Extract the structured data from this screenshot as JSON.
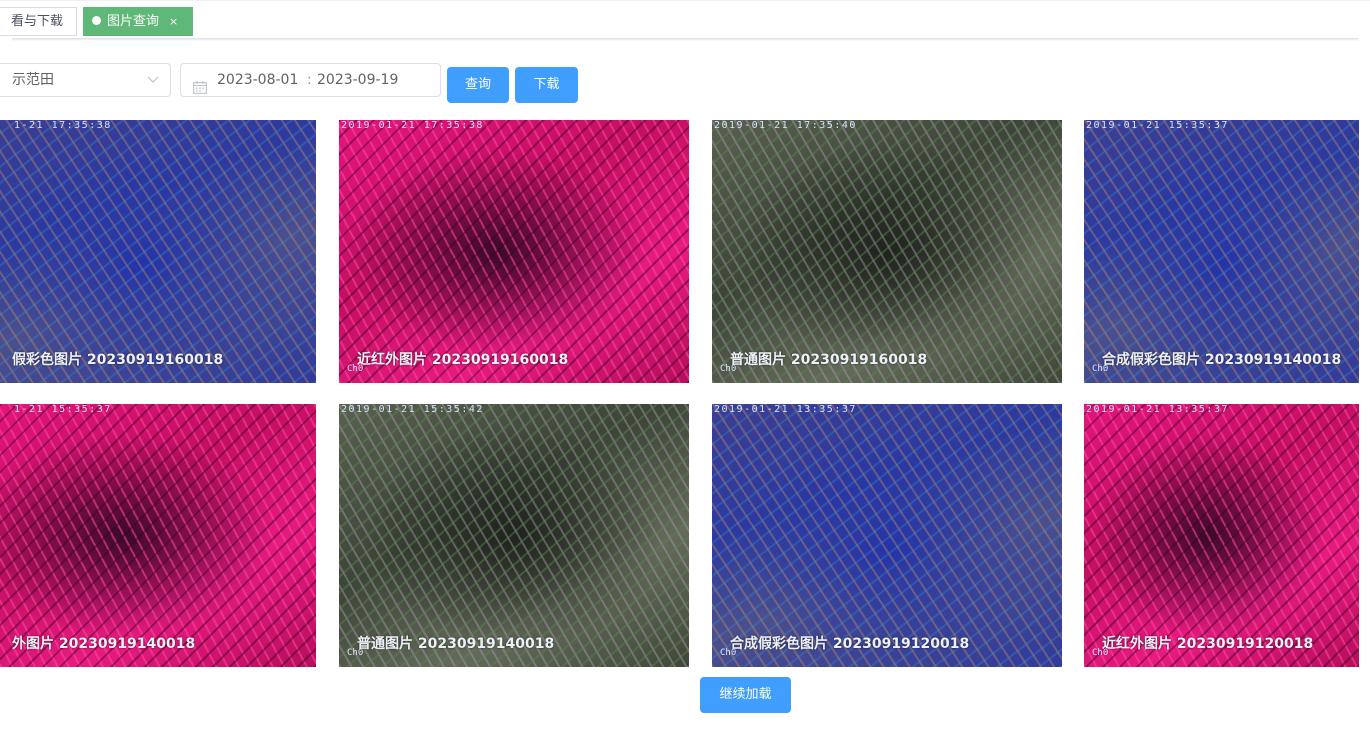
{
  "tabs": [
    {
      "label": "看与下载",
      "active": false
    },
    {
      "label": "图片查询",
      "active": true,
      "close": "×"
    }
  ],
  "filters": {
    "select_value": "示范田",
    "date_start": "2023-08-01",
    "date_sep": ":",
    "date_end": "2023-09-19"
  },
  "buttons": {
    "query": "查询",
    "download": "下载",
    "load_more": "继续加载"
  },
  "images": [
    {
      "type": "falsecolor",
      "stamp": "1-21 17:35:38",
      "ch": "",
      "caption": "假彩色图片 20230919160018"
    },
    {
      "type": "nir",
      "stamp": "2019-01-21 17:35:38",
      "ch": "Ch0",
      "caption": "近红外图片 20230919160018"
    },
    {
      "type": "normal",
      "stamp": "2019-01-21 17:35:40",
      "ch": "Ch0",
      "caption": "普通图片 20230919160018"
    },
    {
      "type": "falsecolor",
      "stamp": "2019-01-21 15:35:37",
      "ch": "Ch0",
      "caption": "合成假彩色图片 20230919140018"
    },
    {
      "type": "nir",
      "stamp": "1-21 15:35:37",
      "ch": "",
      "caption": "外图片 20230919140018"
    },
    {
      "type": "normal",
      "stamp": "2019-01-21 15:35:42",
      "ch": "Ch0",
      "caption": "普通图片 20230919140018"
    },
    {
      "type": "falsecolor",
      "stamp": "2019-01-21 13:35:37",
      "ch": "Ch0",
      "caption": "合成假彩色图片 20230919120018"
    },
    {
      "type": "nir",
      "stamp": "2019-01-21 13:35:37",
      "ch": "Ch0",
      "caption": "近红外图片 20230919120018"
    }
  ],
  "colors": {
    "primary": "#409eff",
    "active_tab": "#5fb878"
  }
}
